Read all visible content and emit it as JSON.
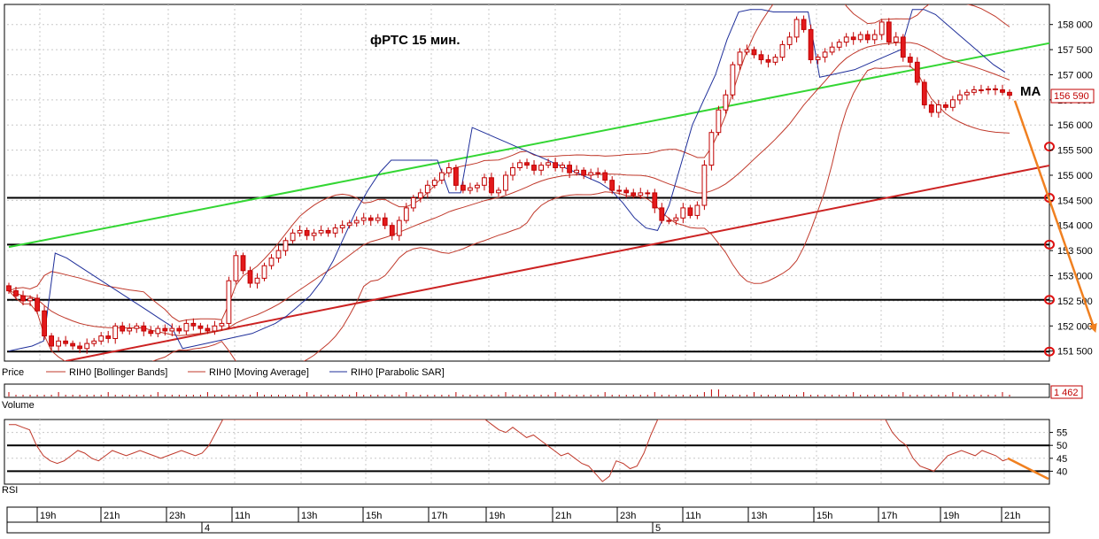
{
  "colors": {
    "background": "#ffffff",
    "grid": "#c8c8c8",
    "candle_up": "#ffffff",
    "candle_down": "#e31a1c",
    "candle_border": "#c00000",
    "bollinger": "#c0392b",
    "moving_average": "#c0392b",
    "parabolic_sar": "#1f2f9a",
    "green_trend": "#33d633",
    "red_trend": "#cc2222",
    "forecast_arrow": "#f08020",
    "level_line": "#000000",
    "current_price_label": "#c00000"
  },
  "chart_data": [
    {
      "type": "candlestick",
      "title": "фРТС   15 мин.",
      "annotation": "MA",
      "ylim": [
        151300,
        158400
      ],
      "y_ticks": [
        "151 500",
        "152 000",
        "152 500",
        "153 000",
        "153 500",
        "154 000",
        "154 500",
        "155 000",
        "155 500",
        "156 000",
        "156 500",
        "157 000",
        "157 500",
        "158 000"
      ],
      "y_tick_values": [
        151500,
        152000,
        152500,
        153000,
        153500,
        154000,
        154500,
        155000,
        155500,
        156000,
        156500,
        157000,
        157500,
        158000
      ],
      "current_price": "156 590",
      "current_price_value": 156590,
      "grid": true,
      "legend": [
        {
          "name": "Price",
          "color": "#000000"
        },
        {
          "name": "RIH0 [Bollinger Bands]",
          "color": "#c0392b"
        },
        {
          "name": "RIH0 [Moving Average]",
          "color": "#c0392b"
        },
        {
          "name": "RIH0 [Parabolic SAR]",
          "color": "#1f2f9a"
        }
      ],
      "horizontal_levels": [
        154550,
        153620,
        152520,
        151490
      ],
      "trendlines": [
        {
          "color": "green",
          "from": [
            0,
            153570
          ],
          "to": [
            155,
            158000
          ]
        },
        {
          "color": "red",
          "from": [
            8,
            151300
          ],
          "to": [
            155,
            155570
          ]
        }
      ],
      "closes": [
        152700,
        152600,
        152500,
        152550,
        152300,
        151800,
        151600,
        151700,
        151650,
        151600,
        151550,
        151650,
        151700,
        151800,
        151750,
        152000,
        151900,
        151950,
        152000,
        151900,
        151850,
        151950,
        151900,
        151950,
        151900,
        152050,
        152000,
        151950,
        151900,
        152000,
        152050,
        152900,
        153400,
        153100,
        152850,
        152950,
        153200,
        153350,
        153500,
        153700,
        153850,
        153900,
        153800,
        153850,
        153900,
        153850,
        153950,
        154000,
        154050,
        154100,
        154150,
        154100,
        154150,
        154000,
        153800,
        154100,
        154350,
        154550,
        154650,
        154800,
        154900,
        155050,
        155150,
        154800,
        154700,
        154750,
        154800,
        154950,
        154650,
        154700,
        155000,
        155150,
        155250,
        155200,
        155100,
        155200,
        155250,
        155150,
        155200,
        155050,
        155100,
        155000,
        155050,
        155050,
        154900,
        154700,
        154700,
        154650,
        154600,
        154650,
        154650,
        154350,
        154100,
        154100,
        154150,
        154350,
        154200,
        154400,
        155200,
        155850,
        156300,
        156600,
        157200,
        157450,
        157500,
        157400,
        157300,
        157250,
        157350,
        157600,
        157750,
        158100,
        157900,
        157300,
        157350,
        157450,
        157550,
        157650,
        157750,
        157700,
        157800,
        157700,
        157800,
        158050,
        157650,
        157750,
        157350,
        157250,
        156850,
        156400,
        156250,
        156400,
        156350,
        156500,
        156600,
        156650,
        156700,
        156700,
        156720,
        156700,
        156650,
        156590
      ],
      "sar": [
        151500,
        151550,
        151600,
        151700,
        153450,
        153350,
        153200,
        153050,
        152900,
        152750,
        152600,
        152450,
        152300,
        152150,
        152000,
        151550,
        151600,
        151650,
        151700,
        151750,
        151800,
        151850,
        151950,
        152050,
        152200,
        152400,
        152600,
        152900,
        153300,
        153800,
        154300,
        154700,
        155050,
        155300,
        155300,
        155300,
        155300,
        155300,
        154650,
        154650,
        155950,
        155850,
        155750,
        155650,
        155550,
        155450,
        155350,
        155250,
        155150,
        155050,
        154950,
        154850,
        154700,
        154450,
        154150,
        153950,
        153900,
        154400,
        155200,
        156000,
        156500,
        157000,
        157700,
        158250,
        158300,
        158300,
        158250,
        158250,
        158250,
        158250,
        156950,
        157000,
        157050,
        157100,
        157200,
        157300,
        157400,
        157500,
        158300,
        158300,
        158200,
        158000,
        157800,
        157600,
        157400,
        157200,
        157050
      ]
    },
    {
      "type": "bar",
      "name": "Volume",
      "last_value": "1 462",
      "last_value_number": 1462
    },
    {
      "type": "line",
      "name": "RSI",
      "ylim": [
        35,
        60
      ],
      "y_ticks": [
        "55",
        "50",
        "45",
        "40"
      ],
      "y_tick_values": [
        55,
        50,
        45,
        40
      ],
      "horizontal_levels": [
        50,
        40
      ],
      "values": [
        58,
        58,
        57,
        56,
        50,
        46,
        44,
        43,
        44,
        46,
        48,
        47,
        45,
        44,
        46,
        48,
        47,
        46,
        47,
        48,
        47,
        46,
        45,
        46,
        47,
        48,
        47,
        46,
        47,
        50,
        55,
        60,
        60,
        60,
        60,
        60,
        60,
        60,
        60,
        60,
        60,
        60,
        60,
        60,
        60,
        60,
        60,
        60,
        60,
        60,
        60,
        60,
        60,
        60,
        60,
        60,
        60,
        60,
        60,
        60,
        60,
        60,
        60,
        60,
        60,
        60,
        60,
        60,
        60,
        60,
        58,
        56,
        55,
        57,
        55,
        53,
        54,
        52,
        50,
        48,
        46,
        47,
        45,
        43,
        42,
        39,
        36,
        38,
        44,
        43,
        41,
        42,
        47,
        54,
        60,
        60,
        60,
        60,
        60,
        60,
        60,
        60,
        60,
        60,
        60,
        60,
        60,
        60,
        60,
        60,
        60,
        60,
        60,
        60,
        60,
        60,
        60,
        60,
        60,
        60,
        60,
        60,
        60,
        60,
        60,
        60,
        60,
        60,
        55,
        52,
        50,
        45,
        42,
        41,
        40,
        43,
        46,
        47,
        48,
        47,
        46,
        48,
        47,
        46,
        44,
        45
      ]
    }
  ],
  "time_axis": {
    "hour_labels": [
      "19h",
      "21h",
      "23h",
      "11h",
      "13h",
      "15h",
      "17h",
      "19h",
      "21h",
      "23h",
      "11h",
      "13h",
      "15h",
      "17h",
      "19h",
      "21h"
    ],
    "day_labels": [
      "4",
      "5"
    ]
  },
  "panels": {
    "price_label": "Price",
    "volume_label": "Volume",
    "rsi_label": "RSI"
  }
}
